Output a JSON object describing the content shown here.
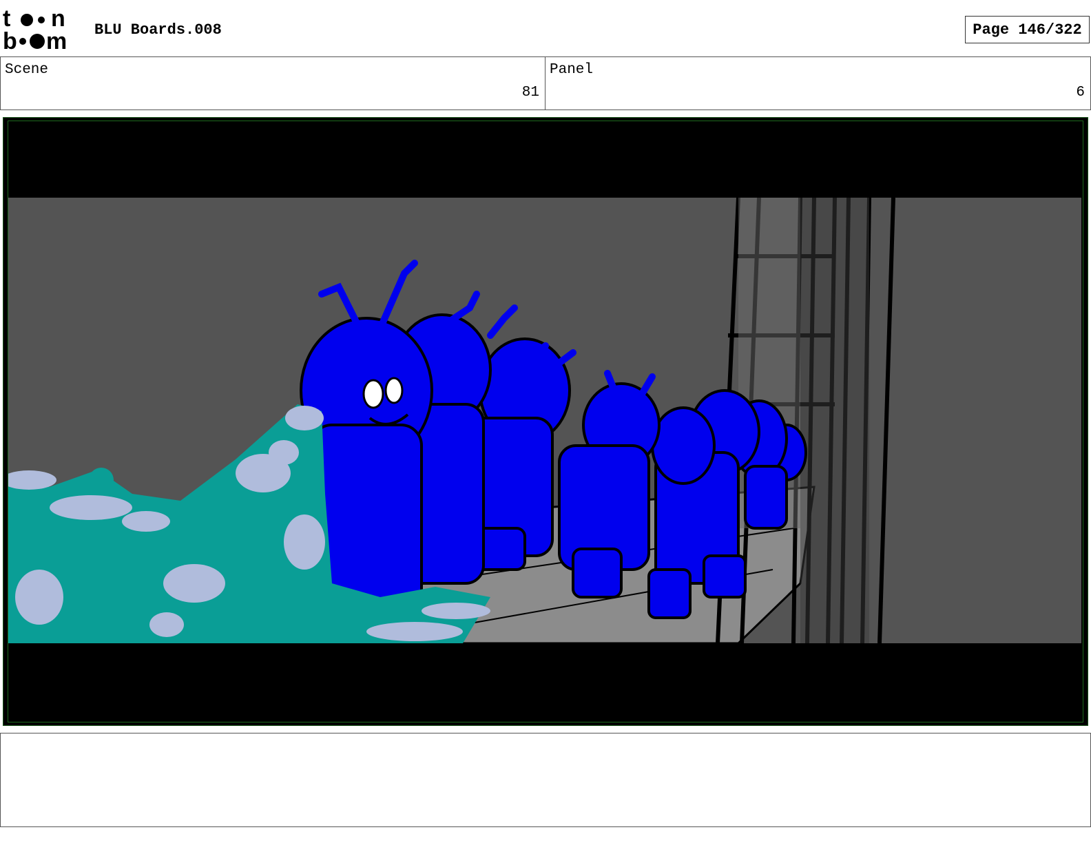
{
  "header": {
    "logo_text": "toon boom",
    "document_title": "BLU Boards.008",
    "page_label": "Page 146/322"
  },
  "info": {
    "scene_label": "Scene",
    "scene_value": "81",
    "panel_label": "Panel",
    "panel_value": "6"
  },
  "colors": {
    "character_blue": "#0000ee",
    "wave_teal": "#0a9e96",
    "foam": "#b0bcdc",
    "background_gray": "#545454",
    "floor_gray": "#8c8c8c",
    "letterbox": "#000000"
  },
  "notes": {
    "text": ""
  }
}
